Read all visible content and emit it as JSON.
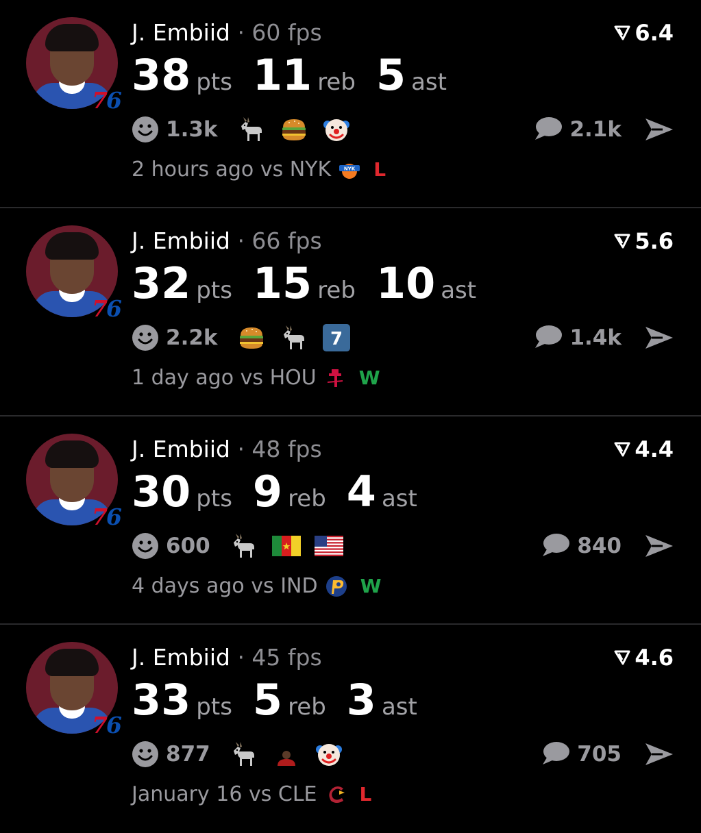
{
  "colors": {
    "loss": "#e0282e",
    "win": "#1fa34a",
    "muted": "#9a9a9f"
  },
  "posts": [
    {
      "player": "J. Embiid",
      "fps": "· 60 fps",
      "rating": "6.4",
      "pts": "38",
      "reb": "11",
      "ast": "5",
      "pts_label": "pts",
      "reb_label": "reb",
      "ast_label": "ast",
      "reaction_count": "1.3k",
      "reactions": [
        "goat-icon",
        "burger-icon",
        "clown-icon"
      ],
      "comments": "2.1k",
      "time": "2 hours ago vs NYK",
      "opponent_logo": "knicks-logo-icon",
      "result": "L",
      "result_type": "loss"
    },
    {
      "player": "J. Embiid",
      "fps": "· 66 fps",
      "rating": "5.6",
      "pts": "32",
      "reb": "15",
      "ast": "10",
      "pts_label": "pts",
      "reb_label": "reb",
      "ast_label": "ast",
      "reaction_count": "2.2k",
      "reactions": [
        "burger-icon",
        "goat-icon",
        "number-seven-icon"
      ],
      "comments": "1.4k",
      "time": "1 day ago vs HOU",
      "opponent_logo": "rockets-logo-icon",
      "result": "W",
      "result_type": "win"
    },
    {
      "player": "J. Embiid",
      "fps": "· 48 fps",
      "rating": "4.4",
      "pts": "30",
      "reb": "9",
      "ast": "4",
      "pts_label": "pts",
      "reb_label": "reb",
      "ast_label": "ast",
      "reaction_count": "600",
      "reactions": [
        "goat-icon",
        "cameroon-flag-icon",
        "usa-flag-icon"
      ],
      "comments": "840",
      "time": "4 days ago vs IND",
      "opponent_logo": "pacers-logo-icon",
      "result": "W",
      "result_type": "win"
    },
    {
      "player": "J. Embiid",
      "fps": "· 45 fps",
      "rating": "4.6",
      "pts": "33",
      "reb": "5",
      "ast": "3",
      "pts_label": "pts",
      "reb_label": "reb",
      "ast_label": "ast",
      "reaction_count": "877",
      "reactions": [
        "goat-icon",
        "player-bust-icon",
        "clown-icon"
      ],
      "comments": "705",
      "time": "January 16 vs CLE",
      "opponent_logo": "cavaliers-logo-icon",
      "result": "L",
      "result_type": "loss"
    }
  ]
}
